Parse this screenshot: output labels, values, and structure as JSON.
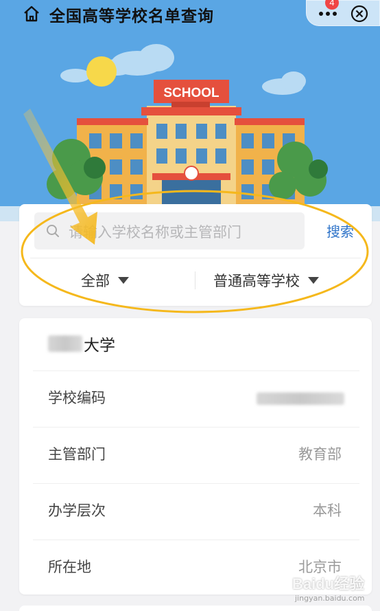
{
  "header": {
    "title": "全国高等学校名单查询",
    "home_icon": "home-icon",
    "more_icon": "more-icon",
    "notification_count": "4",
    "close_icon": "close-icon"
  },
  "banner": {
    "sign_text": "SCHOOL"
  },
  "search": {
    "placeholder": "请输入学校名称或主管部门",
    "button_label": "搜索",
    "filter_region": "全部",
    "filter_type": "普通高等学校"
  },
  "result": {
    "name_visible": "大学",
    "rows": [
      {
        "label": "学校编码",
        "value": ""
      },
      {
        "label": "主管部门",
        "value": "教育部"
      },
      {
        "label": "办学层次",
        "value": "本科"
      },
      {
        "label": "所在地",
        "value": "北京市"
      }
    ]
  },
  "watermark": {
    "text": "Baidu经验",
    "subtext": "jingyan.baidu.com"
  },
  "colors": {
    "sky": "#5aa6e4",
    "accent": "#2f74c9",
    "badge": "#f04545",
    "annotation": "#f5b81c"
  }
}
